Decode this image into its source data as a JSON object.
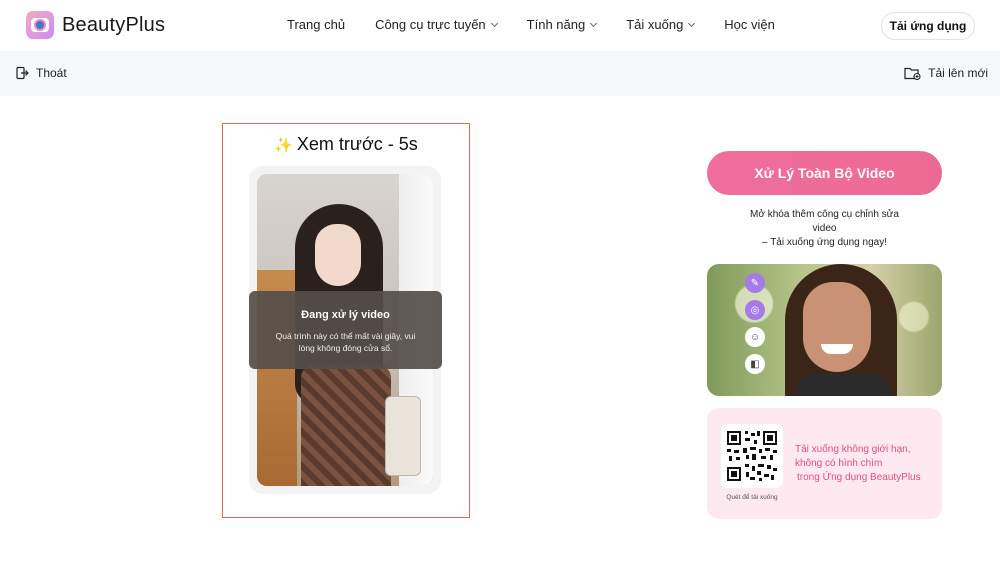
{
  "header": {
    "brand": "BeautyPlus",
    "nav": [
      {
        "label": "Trang chủ",
        "has_dropdown": false
      },
      {
        "label": "Công cụ trực tuyến",
        "has_dropdown": true
      },
      {
        "label": "Tính năng",
        "has_dropdown": true
      },
      {
        "label": "Tải xuống",
        "has_dropdown": true
      },
      {
        "label": "Học viện",
        "has_dropdown": false
      }
    ],
    "cta": "Tải ứng dụng"
  },
  "toolbar": {
    "exit": "Thoát",
    "upload": "Tải lên mới"
  },
  "preview": {
    "title": "Xem trước - 5s",
    "overlay_title": "Đang xử lý video",
    "overlay_desc": "Quá trình này có thể mất vài giây, vui lòng không đóng cửa sổ."
  },
  "side": {
    "process_button": "Xử Lý Toàn Bộ Video",
    "unlock_line1": "Mở khóa thêm công cụ chỉnh sửa video",
    "unlock_line2": "– Tải xuống ứng dụng ngay!",
    "qr_caption": "Quét để tải xuống",
    "qr_line1": "Tải xuống không giới hạn,",
    "qr_line2": "không có hình chìm",
    "qr_line3": "trong Ứng dụng BeautyPlus"
  },
  "icons": {
    "exit": "exit-icon",
    "upload": "folder-upload-icon",
    "tools": [
      "retouch-icon",
      "filter-icon",
      "face-icon",
      "beauty-icon"
    ]
  },
  "colors": {
    "accent": "#ec6a92",
    "frame": "#e06a5a",
    "promo_bg": "#fde9ef",
    "promo_text": "#e24f79"
  }
}
